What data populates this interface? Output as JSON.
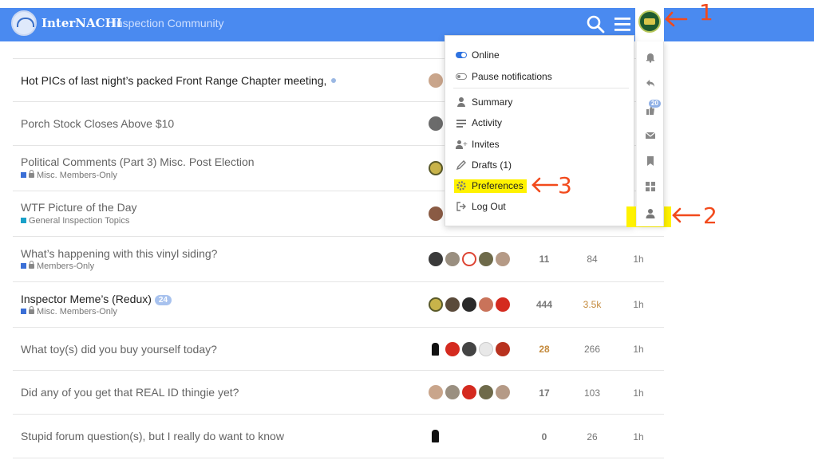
{
  "header": {
    "brand": "InterNACHI",
    "subtitle": "Inspection Community",
    "search_icon": "search-icon",
    "menu_icon": "hamburger-menu-icon",
    "brand_color": "#4a8af0"
  },
  "user_menu": {
    "items": [
      {
        "label": "Online",
        "icon": "toggle-on-icon"
      },
      {
        "label": "Pause notifications",
        "icon": "toggle-off-icon"
      },
      {
        "label": "Summary",
        "icon": "user-icon"
      },
      {
        "label": "Activity",
        "icon": "activity-list-icon"
      },
      {
        "label": "Invites",
        "icon": "user-plus-icon"
      },
      {
        "label": "Drafts (1)",
        "icon": "pencil-icon"
      },
      {
        "label": "Preferences",
        "icon": "gear-icon"
      },
      {
        "label": "Log Out",
        "icon": "sign-out-icon"
      }
    ]
  },
  "side_panel": {
    "icons": [
      "bell-icon",
      "reply-icon",
      "likes-icon",
      "envelope-icon",
      "bookmark-icon",
      "grid-icon",
      "user-icon"
    ],
    "likes_badge": "20"
  },
  "topics": [
    {
      "title": "Hot PICs of last night’s packed Front Range Chapter meeting,",
      "category": "",
      "unread": true,
      "replies": "",
      "views": "",
      "activity": ""
    },
    {
      "title": "Porch Stock Closes Above $10",
      "category": "",
      "unread": false,
      "replies": "",
      "views": "",
      "activity": ""
    },
    {
      "title": "Political Comments (Part 3) Misc. Post Election",
      "category": "Misc. Members-Only",
      "unread": false,
      "replies": "",
      "views": "",
      "activity": ""
    },
    {
      "title": "WTF Picture of the Day",
      "category": "General Inspection Topics",
      "unread": false,
      "replies": "",
      "views": "",
      "activity": ""
    },
    {
      "title": "What’s happening with this vinyl siding?",
      "category": "Members-Only",
      "unread": false,
      "replies": "11",
      "views": "84",
      "activity": "1h"
    },
    {
      "title": "Inspector Meme’s (Redux)",
      "category": "Misc. Members-Only",
      "unread": true,
      "badge": "24",
      "replies": "444",
      "views": "3.5k",
      "activity": "1h"
    },
    {
      "title": "What toy(s) did you buy yourself today?",
      "category": "",
      "unread": false,
      "replies": "28",
      "views": "266",
      "activity": "1h"
    },
    {
      "title": "Did any of you get that REAL ID thingie yet?",
      "category": "",
      "unread": false,
      "replies": "17",
      "views": "103",
      "activity": "1h"
    },
    {
      "title": "Stupid forum question(s), but I really do want to know",
      "category": "",
      "unread": false,
      "replies": "0",
      "views": "26",
      "activity": "1h"
    }
  ],
  "annotations": {
    "one": "1",
    "two": "2",
    "three": "3"
  },
  "colors": {
    "highlight": "#fff200",
    "annotation": "#f24a1c",
    "category_blue": "#3b6fd6",
    "category_teal": "#1aa1c9"
  }
}
